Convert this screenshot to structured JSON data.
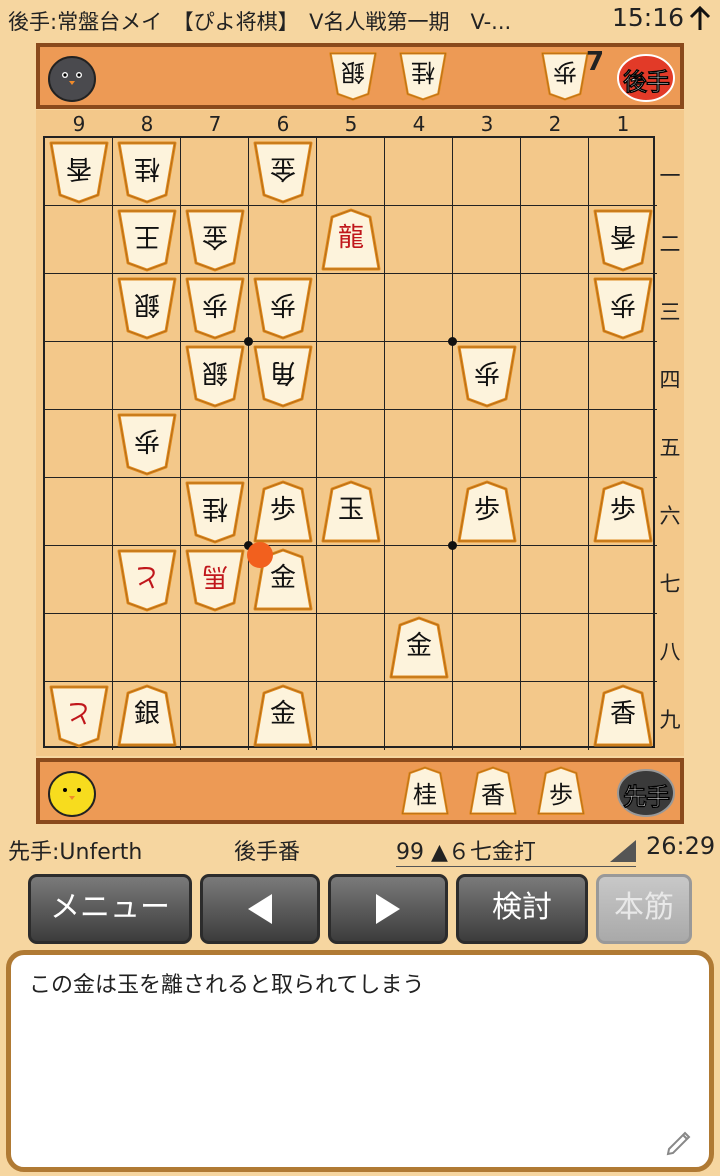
{
  "status_bar": {
    "title": "後手:常盤台メイ　【ぴよ将棋】　V名人戦第一期　V-...",
    "clock": "15:16",
    "sync_icon": "sync-arrow-up-icon"
  },
  "gote": {
    "badge": "後手",
    "avatar_icon": "gray-chick-icon",
    "hand": [
      {
        "piece": "銀",
        "count": ""
      },
      {
        "piece": "桂",
        "count": ""
      },
      {
        "piece": "歩",
        "count": "7"
      }
    ]
  },
  "sente": {
    "badge": "先手",
    "avatar_icon": "yellow-chick-icon",
    "hand": [
      {
        "piece": "桂",
        "count": ""
      },
      {
        "piece": "香",
        "count": ""
      },
      {
        "piece": "歩",
        "count": ""
      }
    ]
  },
  "board": {
    "files": [
      "9",
      "8",
      "7",
      "6",
      "5",
      "4",
      "3",
      "2",
      "1"
    ],
    "ranks": [
      "一",
      "二",
      "三",
      "四",
      "五",
      "六",
      "七",
      "八",
      "九"
    ],
    "pieces": [
      {
        "file": 9,
        "rank": 1,
        "char": "香",
        "owner": "gote",
        "promoted": false
      },
      {
        "file": 8,
        "rank": 1,
        "char": "桂",
        "owner": "gote",
        "promoted": false
      },
      {
        "file": 6,
        "rank": 1,
        "char": "金",
        "owner": "gote",
        "promoted": false
      },
      {
        "file": 8,
        "rank": 2,
        "char": "王",
        "owner": "gote",
        "promoted": false
      },
      {
        "file": 7,
        "rank": 2,
        "char": "金",
        "owner": "gote",
        "promoted": false
      },
      {
        "file": 5,
        "rank": 2,
        "char": "龍",
        "owner": "sente",
        "promoted": true
      },
      {
        "file": 1,
        "rank": 2,
        "char": "香",
        "owner": "gote",
        "promoted": false
      },
      {
        "file": 8,
        "rank": 3,
        "char": "銀",
        "owner": "gote",
        "promoted": false
      },
      {
        "file": 7,
        "rank": 3,
        "char": "歩",
        "owner": "gote",
        "promoted": false
      },
      {
        "file": 6,
        "rank": 3,
        "char": "歩",
        "owner": "gote",
        "promoted": false
      },
      {
        "file": 1,
        "rank": 3,
        "char": "歩",
        "owner": "gote",
        "promoted": false
      },
      {
        "file": 7,
        "rank": 4,
        "char": "銀",
        "owner": "gote",
        "promoted": false
      },
      {
        "file": 6,
        "rank": 4,
        "char": "角",
        "owner": "gote",
        "promoted": false
      },
      {
        "file": 3,
        "rank": 4,
        "char": "歩",
        "owner": "gote",
        "promoted": false
      },
      {
        "file": 8,
        "rank": 5,
        "char": "歩",
        "owner": "gote",
        "promoted": false
      },
      {
        "file": 7,
        "rank": 6,
        "char": "桂",
        "owner": "gote",
        "promoted": false
      },
      {
        "file": 6,
        "rank": 6,
        "char": "歩",
        "owner": "sente",
        "promoted": false
      },
      {
        "file": 5,
        "rank": 6,
        "char": "玉",
        "owner": "sente",
        "promoted": false
      },
      {
        "file": 3,
        "rank": 6,
        "char": "歩",
        "owner": "sente",
        "promoted": false
      },
      {
        "file": 1,
        "rank": 6,
        "char": "歩",
        "owner": "sente",
        "promoted": false
      },
      {
        "file": 8,
        "rank": 7,
        "char": "と",
        "owner": "gote",
        "promoted": true
      },
      {
        "file": 7,
        "rank": 7,
        "char": "馬",
        "owner": "gote",
        "promoted": true
      },
      {
        "file": 6,
        "rank": 7,
        "char": "金",
        "owner": "sente",
        "promoted": false
      },
      {
        "file": 4,
        "rank": 8,
        "char": "金",
        "owner": "sente",
        "promoted": false
      },
      {
        "file": 9,
        "rank": 9,
        "char": "と",
        "owner": "gote",
        "promoted": true
      },
      {
        "file": 8,
        "rank": 9,
        "char": "銀",
        "owner": "sente",
        "promoted": false
      },
      {
        "file": 6,
        "rank": 9,
        "char": "金",
        "owner": "sente",
        "promoted": false
      },
      {
        "file": 1,
        "rank": 9,
        "char": "香",
        "owner": "sente",
        "promoted": false
      }
    ],
    "last_move": {
      "file": 6,
      "rank": 7
    }
  },
  "info": {
    "sente_name": "先手:Unferth",
    "turn": "後手番",
    "move_text": "99 ▲６七金打",
    "time": "26:29"
  },
  "buttons": {
    "menu": "メニュー",
    "back_icon": "triangle-left-icon",
    "forward_icon": "triangle-right-icon",
    "study": "検討",
    "mainline": "本筋"
  },
  "comment": {
    "text": "この金は玉を離されると取られてしまう",
    "edit_icon": "pencil-icon"
  },
  "colors": {
    "board": "#f3c88a",
    "hand_bar": "#ed9a55",
    "hand_border": "#8a4a1c",
    "piece_face": "#fdf3dc",
    "piece_edge": "#e08a1e",
    "promoted_text": "#c0161b",
    "last_move": "#f2601e",
    "comment_border": "#b07a34"
  }
}
